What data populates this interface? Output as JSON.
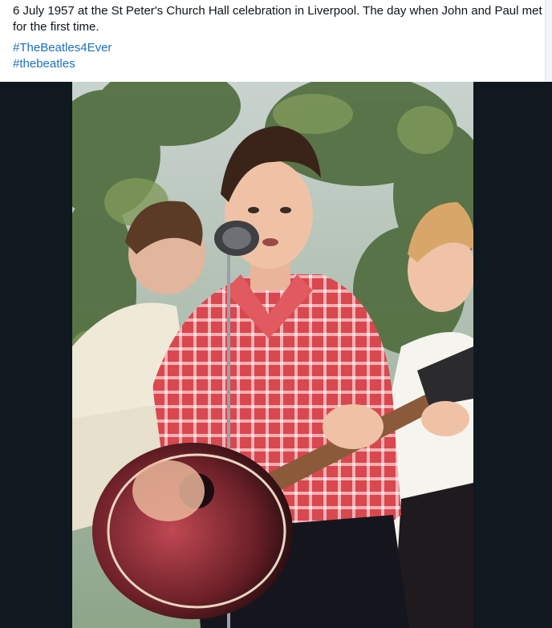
{
  "post": {
    "text": "6 July 1957 at the St Peter's Church Hall celebration in Liverpool. The day when John and Paul met for the first time.",
    "hashtags": [
      "#TheBeatles4Ever",
      "#thebeatles"
    ]
  },
  "colors": {
    "hashtag": "#1d6fc1",
    "media_background": "#101820",
    "shirt": "#d9474f"
  }
}
